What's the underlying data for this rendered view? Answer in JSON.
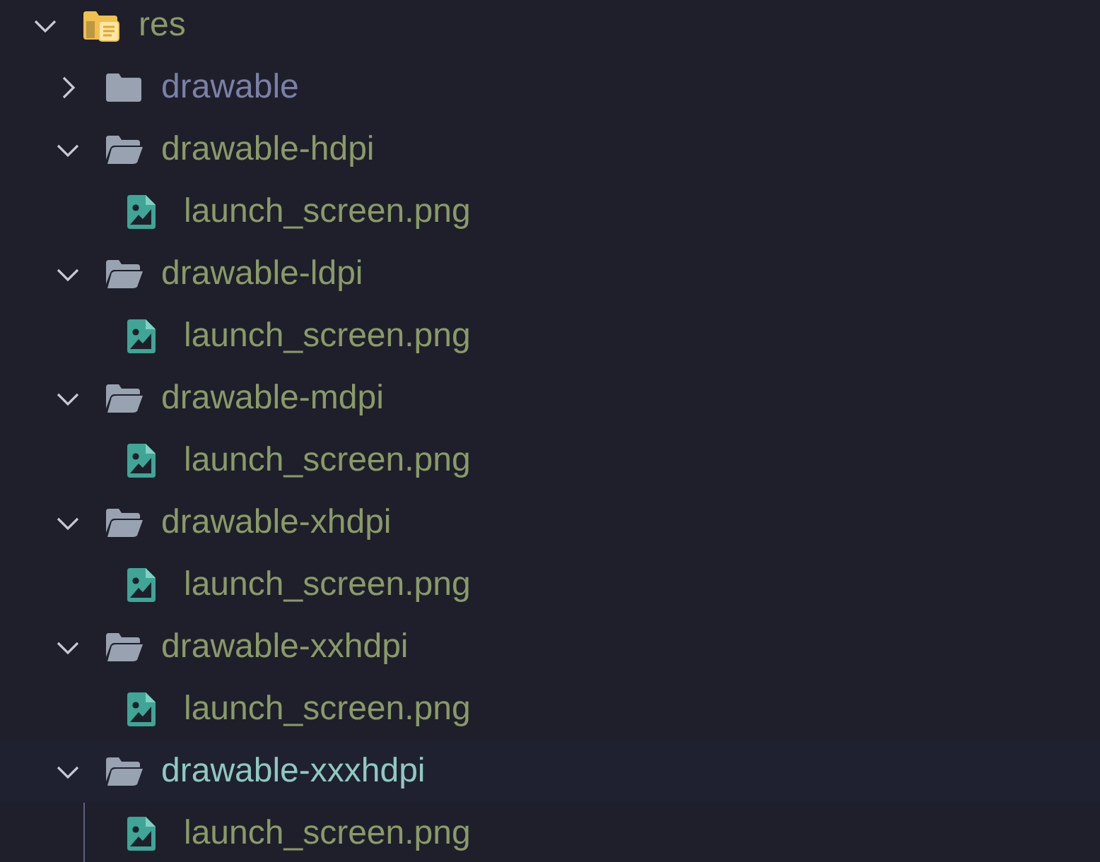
{
  "tree": [
    {
      "kind": "folder",
      "label": "res",
      "expanded": true,
      "selected": false,
      "ignored": false,
      "children": [
        {
          "kind": "folder",
          "label": "drawable",
          "expanded": false,
          "selected": false,
          "ignored": true
        },
        {
          "kind": "folder",
          "label": "drawable-hdpi",
          "expanded": true,
          "selected": false,
          "ignored": false,
          "children": [
            {
              "kind": "file",
              "label": "launch_screen.png",
              "selected": false,
              "ignored": false
            }
          ]
        },
        {
          "kind": "folder",
          "label": "drawable-ldpi",
          "expanded": true,
          "selected": false,
          "ignored": false,
          "children": [
            {
              "kind": "file",
              "label": "launch_screen.png",
              "selected": false,
              "ignored": false
            }
          ]
        },
        {
          "kind": "folder",
          "label": "drawable-mdpi",
          "expanded": true,
          "selected": false,
          "ignored": false,
          "children": [
            {
              "kind": "file",
              "label": "launch_screen.png",
              "selected": false,
              "ignored": false
            }
          ]
        },
        {
          "kind": "folder",
          "label": "drawable-xhdpi",
          "expanded": true,
          "selected": false,
          "ignored": false,
          "children": [
            {
              "kind": "file",
              "label": "launch_screen.png",
              "selected": false,
              "ignored": false
            }
          ]
        },
        {
          "kind": "folder",
          "label": "drawable-xxhdpi",
          "expanded": true,
          "selected": false,
          "ignored": false,
          "children": [
            {
              "kind": "file",
              "label": "launch_screen.png",
              "selected": false,
              "ignored": false
            }
          ]
        },
        {
          "kind": "folder",
          "label": "drawable-xxxhdpi",
          "expanded": true,
          "selected": true,
          "ignored": false,
          "children": [
            {
              "kind": "file",
              "label": "launch_screen.png",
              "selected": false,
              "ignored": false
            }
          ]
        }
      ]
    }
  ]
}
